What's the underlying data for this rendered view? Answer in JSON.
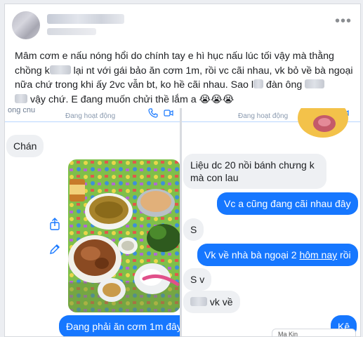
{
  "post": {
    "caption_parts": {
      "p1": "Mâm cơm e nấu nóng hổi do chính tay e hì hục nấu lúc tối vậy mà thằng chồng k",
      "p2": " lại nt với gái bảo ăn cơm 1m, rồi vc cãi nhau, vk bỏ về bà ngoại nữa chứ trong khi ấy 2vc vẫn bt, ko hề cãi nhau. Sao l",
      "p3": " đàn ông ",
      "p4": " vậy chứ. E đang muốn chửi thề lắm a 😭😭😭"
    },
    "more_icon": "more-horizontal-icon"
  },
  "left_chat": {
    "title": "ông chủ",
    "status": "Đang hoạt động",
    "messages": {
      "m1": "Chán",
      "m2": "Đang phải ăn cơm 1m đây"
    },
    "icons": [
      "phone-icon",
      "video-icon",
      "share-icon",
      "edit-icon"
    ]
  },
  "right_chat": {
    "status": "Đang hoạt động",
    "messages": {
      "m1": "Liệu dc 20 nồi bánh chưng k mà con lau",
      "m1_line1": "Liệu dc 20 nồi bánh chưng k",
      "m1_line2": "mà  con lau",
      "m2": "Vc a cũng đang cãi nhau đây",
      "m3": "S",
      "m4_pre": "Vk về nhà bà ngoại 2 ",
      "m4_link": "hôm nay",
      "m4_post": " rồi",
      "m5": "S v",
      "m6": " vk về",
      "m7": "Kệ"
    },
    "chip_label": "Ma Kin"
  },
  "colors": {
    "outgoing_bubble": "#1677ff",
    "incoming_bubble": "#eef0f3"
  }
}
